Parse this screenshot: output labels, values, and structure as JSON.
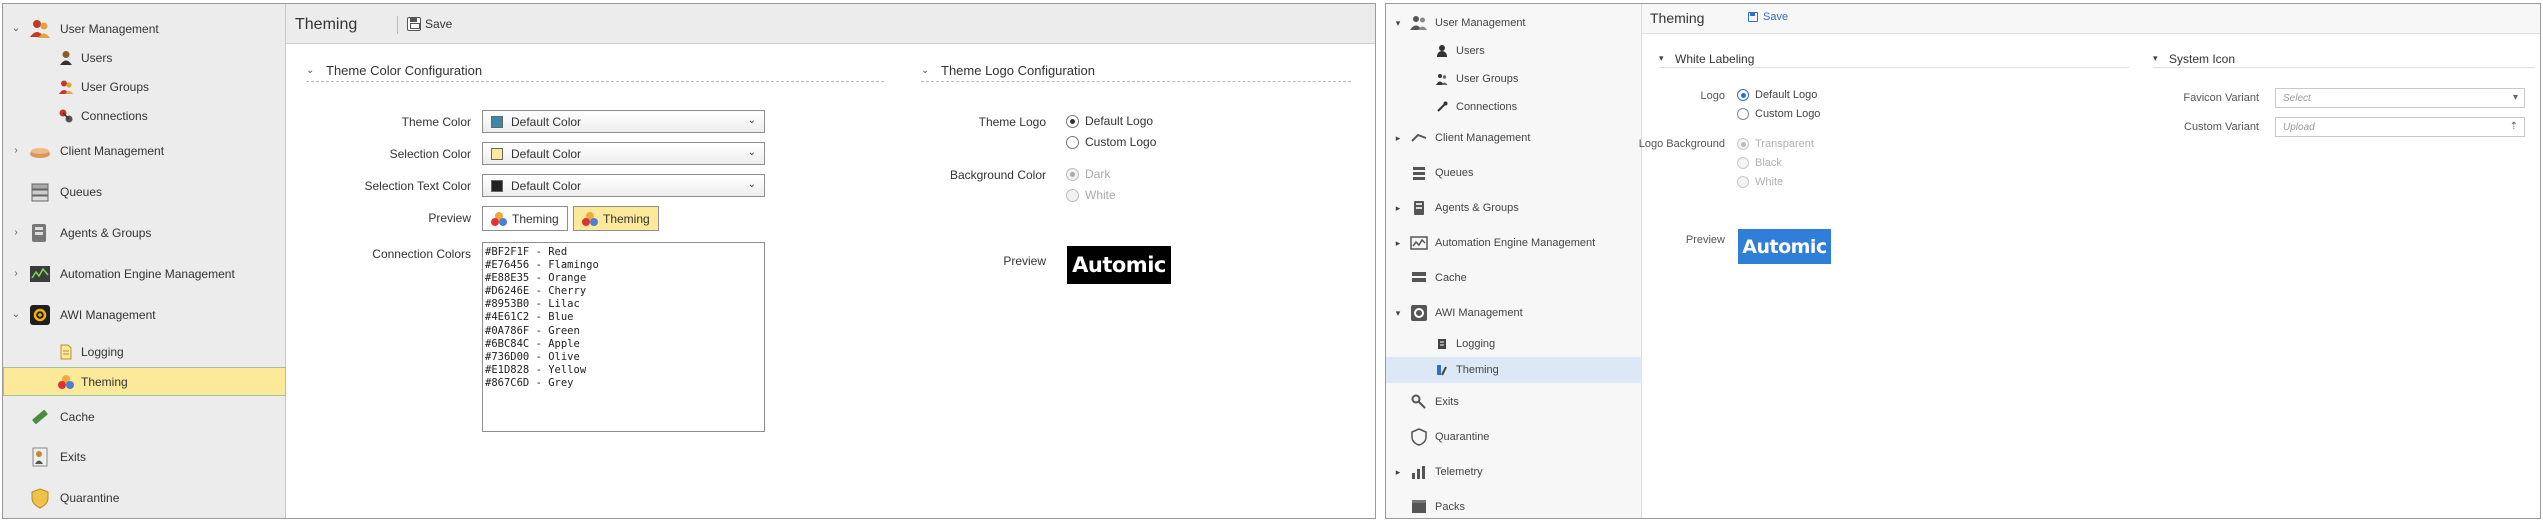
{
  "left": {
    "sidebar": {
      "items": [
        {
          "label": "User Management",
          "expanded": true,
          "icon": "users-group-icon"
        },
        {
          "label": "Users",
          "icon": "user-icon"
        },
        {
          "label": "User Groups",
          "icon": "user-group-icon"
        },
        {
          "label": "Connections",
          "icon": "connections-icon"
        },
        {
          "label": "Client Management",
          "expanded": false,
          "icon": "client-icon"
        },
        {
          "label": "Queues",
          "icon": "queues-icon"
        },
        {
          "label": "Agents & Groups",
          "expanded": false,
          "icon": "agents-icon"
        },
        {
          "label": "Automation Engine Management",
          "expanded": false,
          "icon": "engine-chart-icon"
        },
        {
          "label": "AWI Management",
          "expanded": true,
          "icon": "awi-gear-icon"
        },
        {
          "label": "Logging",
          "icon": "logging-icon"
        },
        {
          "label": "Theming",
          "selected": true,
          "icon": "theming-icon"
        },
        {
          "label": "Cache",
          "icon": "cache-icon"
        },
        {
          "label": "Exits",
          "icon": "exits-icon"
        },
        {
          "label": "Quarantine",
          "icon": "quarantine-shield-icon"
        }
      ]
    },
    "header": {
      "title": "Theming",
      "save_label": "Save"
    },
    "color_section": {
      "title": "Theme Color Configuration",
      "theme_color_label": "Theme Color",
      "theme_color_value": "Default Color",
      "theme_color_swatch": "#3a87a6",
      "selection_color_label": "Selection Color",
      "selection_color_value": "Default Color",
      "selection_color_swatch": "#fce99a",
      "selection_text_color_label": "Selection Text Color",
      "selection_text_color_value": "Default Color",
      "selection_text_color_swatch": "#222222",
      "preview_label": "Preview",
      "preview_button_1": "Theming",
      "preview_button_2": "Theming",
      "connection_colors_label": "Connection Colors",
      "connection_colors": "#BF2F1F - Red\n#E76456 - Flamingo\n#E88E35 - Orange\n#D6246E - Cherry\n#8953B0 - Lilac\n#4E61C2 - Blue\n#0A786F - Green\n#6BC84C - Apple\n#736D00 - Olive\n#E1D828 - Yellow\n#867C6D - Grey"
    },
    "logo_section": {
      "title": "Theme Logo Configuration",
      "theme_logo_label": "Theme Logo",
      "logo_options": [
        "Default Logo",
        "Custom Logo"
      ],
      "background_color_label": "Background Color",
      "background_options": [
        "Dark",
        "White"
      ],
      "preview_label": "Preview",
      "logo_text": "Automic"
    }
  },
  "right": {
    "sidebar": {
      "items": [
        {
          "label": "User Management",
          "expanded": true,
          "icon": "users-group-icon"
        },
        {
          "label": "Users",
          "icon": "user-icon"
        },
        {
          "label": "User Groups",
          "icon": "user-group-icon"
        },
        {
          "label": "Connections",
          "icon": "connections-icon"
        },
        {
          "label": "Client Management",
          "expanded": false,
          "icon": "client-icon"
        },
        {
          "label": "Queues",
          "icon": "queues-icon"
        },
        {
          "label": "Agents & Groups",
          "expanded": false,
          "icon": "agents-icon"
        },
        {
          "label": "Automation Engine Management",
          "expanded": false,
          "icon": "engine-chart-icon"
        },
        {
          "label": "Cache",
          "icon": "cache-icon"
        },
        {
          "label": "AWI Management",
          "expanded": true,
          "icon": "awi-gear-icon"
        },
        {
          "label": "Logging",
          "icon": "logging-icon"
        },
        {
          "label": "Theming",
          "selected": true,
          "icon": "theming-icon"
        },
        {
          "label": "Exits",
          "icon": "exits-icon"
        },
        {
          "label": "Quarantine",
          "icon": "quarantine-shield-icon"
        },
        {
          "label": "Telemetry",
          "expanded": false,
          "icon": "telemetry-icon"
        },
        {
          "label": "Packs",
          "icon": "packs-icon"
        }
      ]
    },
    "header": {
      "title": "Theming",
      "save_label": "Save"
    },
    "white_labeling": {
      "title": "White Labeling",
      "logo_label": "Logo",
      "logo_options": [
        "Default Logo",
        "Custom Logo"
      ],
      "logo_background_label": "Logo Background",
      "background_options": [
        "Transparent",
        "Black",
        "White"
      ],
      "preview_label": "Preview",
      "logo_text": "Automic"
    },
    "system_icon": {
      "title": "System Icon",
      "favicon_variant_label": "Favicon Variant",
      "favicon_placeholder": "Select",
      "custom_variant_label": "Custom Variant",
      "custom_placeholder": "Upload"
    }
  },
  "colors": {
    "accent_blue": "#2f6fc9",
    "selection_yellow": "#fce99a"
  }
}
